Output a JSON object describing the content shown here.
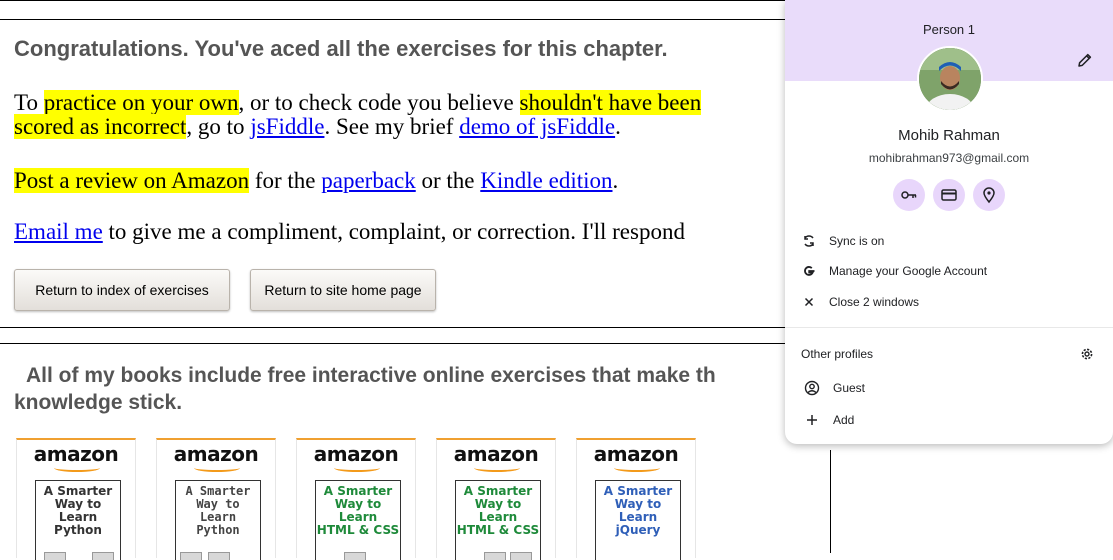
{
  "content": {
    "congrats": "Congratulations. You've aced all the exercises for this chapter.",
    "practice": {
      "to": "To ",
      "practice_link": "practice on your own",
      "middle": ", or to check code you believe ",
      "shouldnt": "shouldn't have been",
      "scored": "scored as incorrect",
      "goto": ", go to ",
      "jsfiddle": "jsFiddle",
      "brief": ". See my brief ",
      "demo": "demo of jsFiddle",
      "end": "."
    },
    "review": {
      "post": "Post a review on Amazon",
      "for_the": " for the ",
      "paperback": "paperback",
      "or_the": " or the ",
      "kindle": "Kindle edition",
      "end": "."
    },
    "email": {
      "link": "Email me",
      "text": " to give me a compliment, complaint, or correction. I'll respond"
    },
    "buttons": {
      "index": "Return to index of exercises",
      "home": "Return to site home page"
    },
    "books_heading_line1": "All of my books include free interactive online exercises that make th",
    "books_heading_line2": "knowledge stick.",
    "books": [
      {
        "brand": "amazon",
        "title": "A Smarter\nWay to\nLearn\nPython",
        "color": "#333333"
      },
      {
        "brand": "amazon",
        "title": "A Smarter\nWay to\nLearn\nPython",
        "color": "#444444"
      },
      {
        "brand": "amazon",
        "title": "A Smarter\nWay to\nLearn\nHTML & CSS",
        "color": "#1e8a3a"
      },
      {
        "brand": "amazon",
        "title": "A Smarter\nWay to\nLearn\nHTML & CSS",
        "color": "#1e8a3a"
      },
      {
        "brand": "amazon",
        "title": "A Smarter\nWay to\nLearn\njQuery",
        "color": "#2f5fb8"
      }
    ]
  },
  "profile_menu": {
    "profile_label": "Person 1",
    "name": "Mohib Rahman",
    "email": "mohibrahman973@gmail.com",
    "quick_icons": [
      "key-icon",
      "card-icon",
      "location-pin-icon"
    ],
    "items": [
      {
        "icon": "sync-icon",
        "label": "Sync is on"
      },
      {
        "icon": "google-icon",
        "label": "Manage your Google Account"
      },
      {
        "icon": "close-icon",
        "label": "Close 2 windows"
      }
    ],
    "other_profiles_label": "Other profiles",
    "other_profiles": [
      {
        "icon": "guest-icon",
        "label": "Guest"
      },
      {
        "icon": "add-icon",
        "label": "Add"
      }
    ],
    "accent": "#e9dcfa"
  }
}
